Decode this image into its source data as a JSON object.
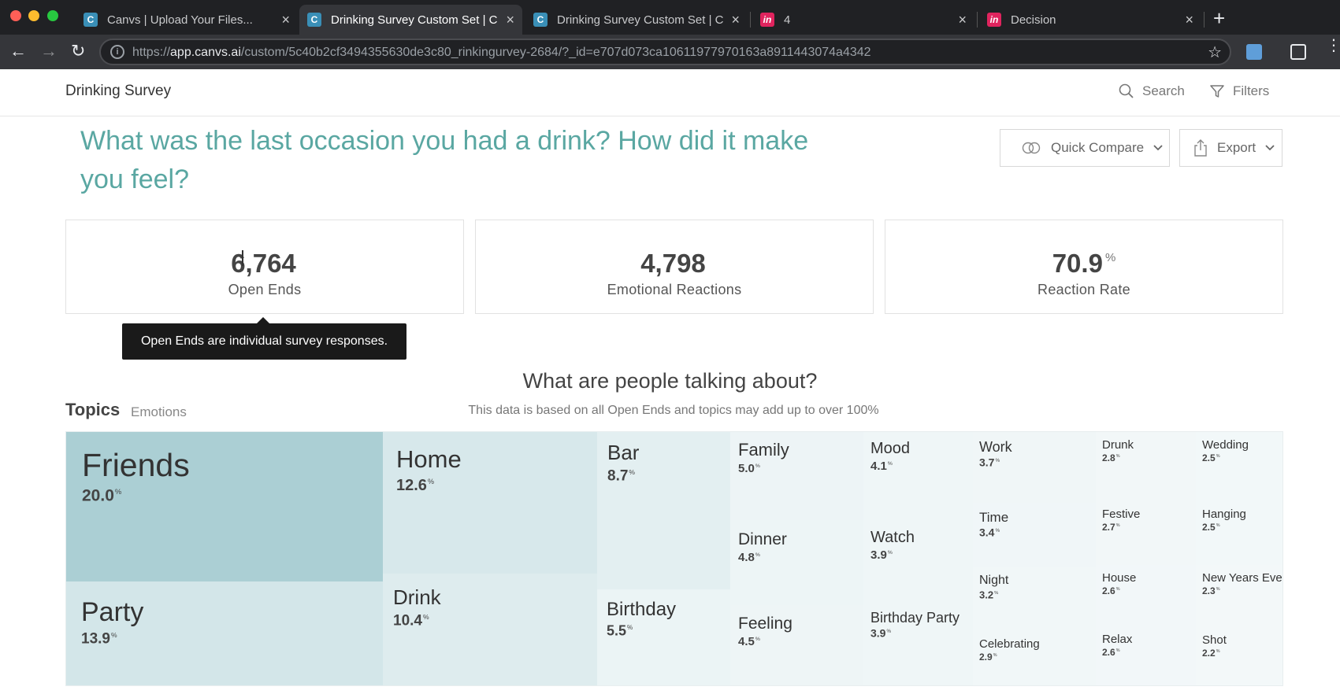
{
  "browser": {
    "tabs": [
      {
        "title": "Canvs | Upload Your Files...",
        "favicon": "canvs-logo-icon",
        "active": false
      },
      {
        "title": "Drinking Survey Custom Set | C",
        "favicon": "canvs-logo-icon",
        "active": true
      },
      {
        "title": "Drinking Survey Custom Set | C",
        "favicon": "canvs-logo-icon",
        "active": false
      },
      {
        "title": "4",
        "favicon": "invision-logo-icon",
        "active": false
      },
      {
        "title": "Decision",
        "favicon": "invision-logo-icon",
        "active": false
      }
    ],
    "url_prefix": "https://",
    "url_host": "app.canvs.ai",
    "url_path": "/custom/5c40b2cf3494355630de3c80_rinkingurvey-2684/?_id=e707d073ca10611977970163a8911443074a4342"
  },
  "header": {
    "brand": "Drinking Survey",
    "search_label": "Search",
    "filters_label": "Filters"
  },
  "question": "What was the last occasion you had a drink? How did it make you feel?",
  "actions": {
    "quick_compare": "Quick Compare",
    "export": "Export"
  },
  "stats": [
    {
      "value": "6,764",
      "unit": "",
      "label": "Open Ends"
    },
    {
      "value": "4,798",
      "unit": "",
      "label": "Emotional Reactions"
    },
    {
      "value": "70.9",
      "unit": "%",
      "label": "Reaction Rate"
    }
  ],
  "tooltip": "Open Ends are individual survey responses.",
  "section": {
    "title": "What are people talking about?",
    "subtitle": "This data is based on all Open Ends and topics may add up to over 100%",
    "tab_topics": "Topics",
    "tab_emotions": "Emotions"
  },
  "colors": {
    "accent": "#5aa7a2",
    "cell_darkest": "#abcfd4",
    "cell_lightest": "#f3f8f9"
  },
  "chart_data": {
    "type": "treemap",
    "unit": "%",
    "items": [
      {
        "name": "Friends",
        "value": 20.0
      },
      {
        "name": "Party",
        "value": 13.9
      },
      {
        "name": "Home",
        "value": 12.6
      },
      {
        "name": "Drink",
        "value": 10.4
      },
      {
        "name": "Bar",
        "value": 8.7
      },
      {
        "name": "Birthday",
        "value": 5.5
      },
      {
        "name": "Family",
        "value": 5.0
      },
      {
        "name": "Dinner",
        "value": 4.8
      },
      {
        "name": "Feeling",
        "value": 4.5
      },
      {
        "name": "Mood",
        "value": 4.1
      },
      {
        "name": "Watch",
        "value": 3.9
      },
      {
        "name": "Birthday Party",
        "value": 3.9
      },
      {
        "name": "Work",
        "value": 3.7
      },
      {
        "name": "Time",
        "value": 3.4
      },
      {
        "name": "Night",
        "value": 3.2
      },
      {
        "name": "Celebrating",
        "value": 2.9
      },
      {
        "name": "Drunk",
        "value": 2.8
      },
      {
        "name": "Festive",
        "value": 2.7
      },
      {
        "name": "House",
        "value": 2.6
      },
      {
        "name": "Relax",
        "value": 2.6
      },
      {
        "name": "Wedding",
        "value": 2.5
      },
      {
        "name": "Hanging",
        "value": 2.5
      },
      {
        "name": "New Years Eve",
        "value": 2.3
      },
      {
        "name": "Shot",
        "value": 2.2
      }
    ]
  }
}
